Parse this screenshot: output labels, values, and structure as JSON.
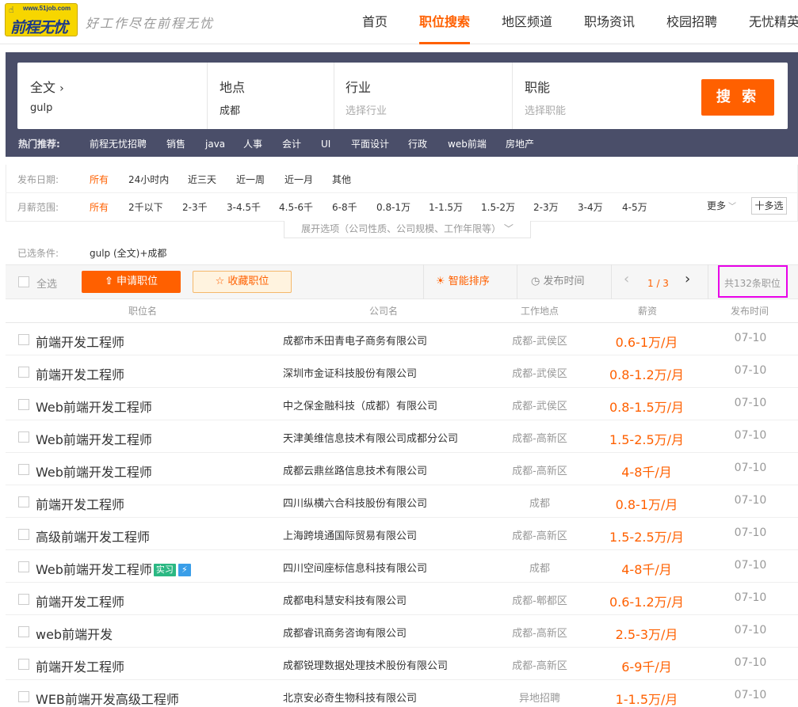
{
  "header": {
    "logo_url_text": "www.51job.com",
    "logo_brand": "前程无忧",
    "slogan": "好工作尽在前程无忧",
    "nav": [
      "首页",
      "职位搜索",
      "地区频道",
      "职场资讯",
      "校园招聘",
      "无忧精英"
    ],
    "active_nav": "职位搜索"
  },
  "search": {
    "keyword_type": "全文",
    "keyword_value": "gulp",
    "location_label": "地点",
    "location_value": "成都",
    "industry_label": "行业",
    "industry_placeholder": "选择行业",
    "function_label": "职能",
    "function_placeholder": "选择职能",
    "button": "搜 索"
  },
  "hot": {
    "label": "热门推荐:",
    "items": [
      "前程无忧招聘",
      "销售",
      "java",
      "人事",
      "会计",
      "UI",
      "平面设计",
      "行政",
      "web前端",
      "房地产"
    ]
  },
  "filters": {
    "date_label": "发布日期:",
    "date_options": [
      "所有",
      "24小时内",
      "近三天",
      "近一周",
      "近一月",
      "其他"
    ],
    "salary_label": "月薪范围:",
    "salary_options": [
      "所有",
      "2千以下",
      "2-3千",
      "3-4.5千",
      "4.5-6千",
      "6-8千",
      "0.8-1万",
      "1-1.5万",
      "1.5-2万",
      "2-3万",
      "3-4万",
      "4-5万"
    ],
    "more": "更多",
    "multi": "十多选",
    "expand": "展开选项（公司性质、公司规模、工作年限等）"
  },
  "selected": {
    "label": "已选条件:",
    "value": "gulp (全文)+成都"
  },
  "toolbar": {
    "select_all": "全选",
    "apply": "申请职位",
    "favorite": "收藏职位",
    "smart_sort": "智能排序",
    "by_time": "发布时间",
    "page": "1 / 3",
    "total": "共132条职位"
  },
  "columns": [
    "职位名",
    "公司名",
    "工作地点",
    "薪资",
    "发布时间"
  ],
  "colors": {
    "accent": "#ff6000",
    "hero": "#4a4e69",
    "highlight": "#e800e8",
    "tag": "#2bb883"
  },
  "jobs": [
    {
      "title": "前端开发工程师",
      "company": "成都市禾田青电子商务有限公司",
      "location": "成都-武侯区",
      "salary": "0.6-1万/月",
      "date": "07-10"
    },
    {
      "title": "前端开发工程师",
      "company": "深圳市金证科技股份有限公司",
      "location": "成都-武侯区",
      "salary": "0.8-1.2万/月",
      "date": "07-10"
    },
    {
      "title": "Web前端开发工程师",
      "company": "中之保金融科技（成都）有限公司",
      "location": "成都-武侯区",
      "salary": "0.8-1.5万/月",
      "date": "07-10"
    },
    {
      "title": "Web前端开发工程师",
      "company": "天津美维信息技术有限公司成都分公司",
      "location": "成都-高新区",
      "salary": "1.5-2.5万/月",
      "date": "07-10"
    },
    {
      "title": "Web前端开发工程师",
      "company": "成都云鼎丝路信息技术有限公司",
      "location": "成都-高新区",
      "salary": "4-8千/月",
      "date": "07-10"
    },
    {
      "title": "前端开发工程师",
      "company": "四川纵横六合科技股份有限公司",
      "location": "成都",
      "salary": "0.8-1万/月",
      "date": "07-10"
    },
    {
      "title": "高级前端开发工程师",
      "company": "上海跨境通国际贸易有限公司",
      "location": "成都-高新区",
      "salary": "1.5-2.5万/月",
      "date": "07-10"
    },
    {
      "title": "Web前端开发工程师",
      "tag": "实习",
      "company": "四川空间座标信息科技有限公司",
      "location": "成都",
      "salary": "4-8千/月",
      "date": "07-10"
    },
    {
      "title": "前端开发工程师",
      "company": "成都电科慧安科技有限公司",
      "location": "成都-郫都区",
      "salary": "0.6-1.2万/月",
      "date": "07-10"
    },
    {
      "title": "web前端开发",
      "company": "成都睿讯商务咨询有限公司",
      "location": "成都-高新区",
      "salary": "2.5-3万/月",
      "date": "07-10"
    },
    {
      "title": "前端开发工程师",
      "company": "成都锐理数据处理技术股份有限公司",
      "location": "成都-高新区",
      "salary": "6-9千/月",
      "date": "07-10"
    },
    {
      "title": "WEB前端开发高级工程师",
      "company": "北京安必奇生物科技有限公司",
      "location": "异地招聘",
      "salary": "1-1.5万/月",
      "date": "07-10"
    }
  ]
}
